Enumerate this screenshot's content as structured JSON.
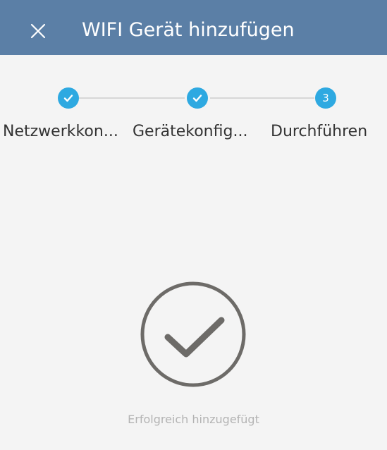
{
  "header": {
    "title": "WIFI Gerät hinzufügen",
    "bg_color": "#5b7fa6"
  },
  "stepper": {
    "active_color": "#2ea9e1",
    "steps": [
      {
        "label": "Netzwerkkon...",
        "state": "done",
        "icon": "check-icon"
      },
      {
        "label": "Gerätekonfig...",
        "state": "done",
        "icon": "check-icon"
      },
      {
        "label": "Durchführen",
        "state": "current",
        "number": "3"
      }
    ]
  },
  "result": {
    "icon": "check-circle-icon",
    "message": "Erfolgreich hinzugefügt"
  }
}
